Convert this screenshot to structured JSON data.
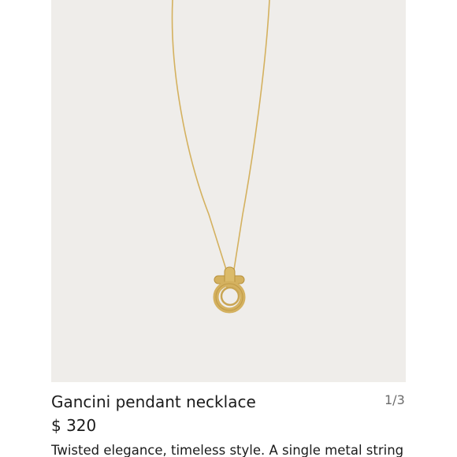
{
  "product": {
    "title": "Gancini pendant necklace",
    "price": "$ 320",
    "description": "Twisted elegance, timeless style. A single metal string",
    "image_page_indicator": "1/3"
  },
  "colors": {
    "image_background": "#efedea",
    "gold": "#d4b15f",
    "gold_dark": "#b8923e",
    "text_primary": "#1b1b1b",
    "text_secondary": "#6b6b6b"
  }
}
